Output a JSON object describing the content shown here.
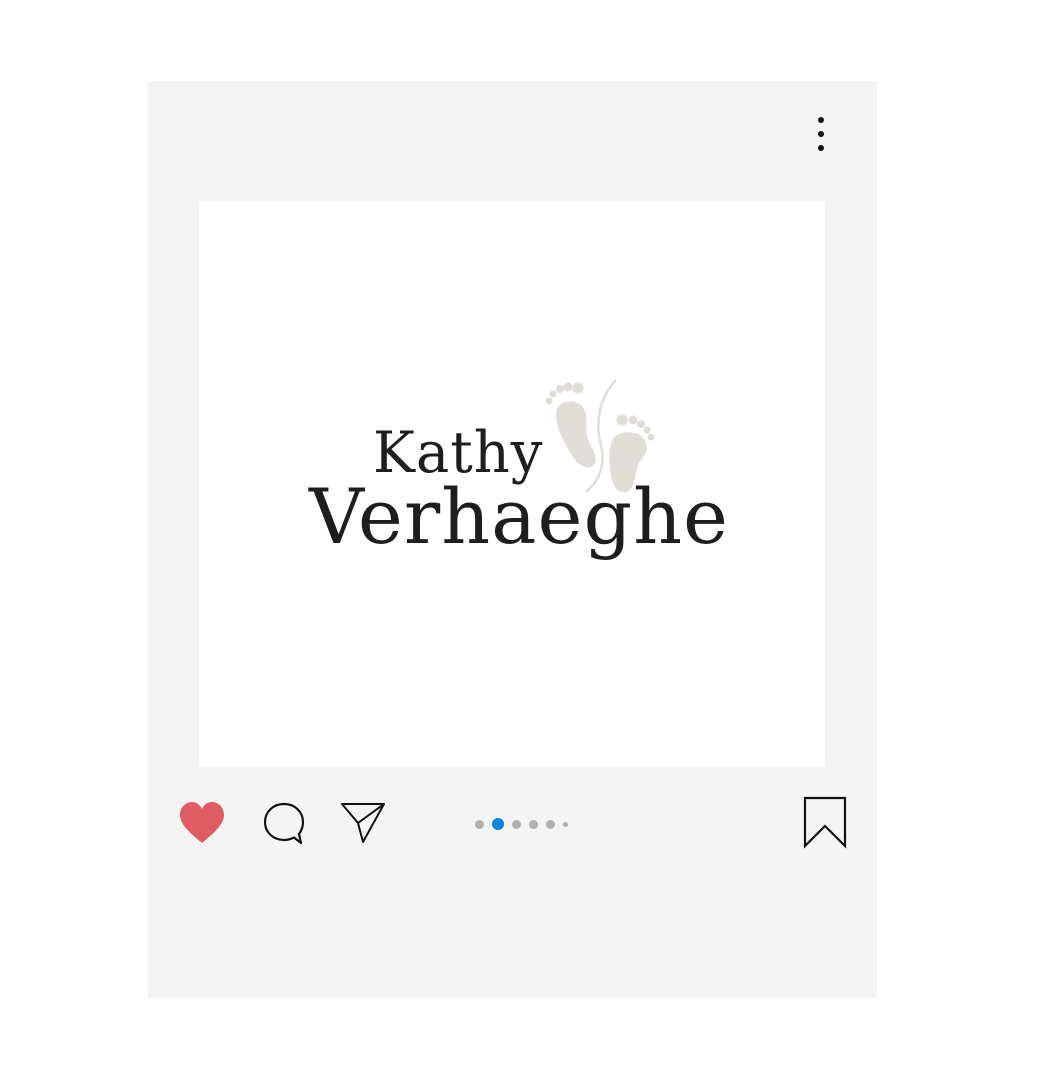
{
  "brand": {
    "first_name": "Kathy",
    "last_name": "Verhaeghe"
  },
  "icons": {
    "more": "more-vertical-icon",
    "like": "heart-icon",
    "comment": "comment-icon",
    "share": "send-icon",
    "save": "bookmark-icon",
    "logo_mark": "footprints-icon"
  },
  "carousel": {
    "total": 6,
    "active_index": 1
  },
  "colors": {
    "like": "#e05c65",
    "active_dot": "#0a84e0",
    "inactive_dot": "#b0b0b0",
    "logo_text": "#1e1e1e",
    "footprints": "#e0ddd7"
  }
}
